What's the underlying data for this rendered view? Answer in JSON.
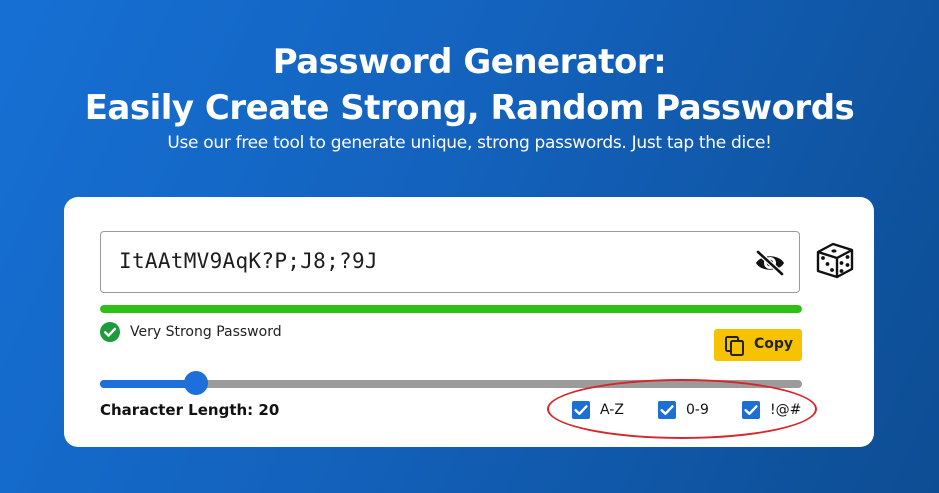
{
  "header": {
    "title_line1": "Password Generator:",
    "title_line2": "Easily Create Strong, Random Passwords",
    "subtitle": "Use our free tool to generate unique, strong passwords. Just tap the dice!"
  },
  "generator": {
    "password": "ItAAtMV9AqK?P;J8;?9J",
    "visibility_icon": "eye-off-icon",
    "dice_icon": "dice-icon",
    "strength": {
      "label": "Very Strong Password",
      "level": 1.0,
      "color": "#2ec013",
      "icon": "check-circle-icon"
    },
    "copy_button": {
      "label": "Copy",
      "icon": "copy-icon",
      "color": "#f7c300"
    },
    "length": {
      "label": "Character Length: 20",
      "value": 20
    },
    "options": [
      {
        "label": "A-Z",
        "checked": true
      },
      {
        "label": "0-9",
        "checked": true
      },
      {
        "label": "!@#",
        "checked": true
      }
    ]
  },
  "colors": {
    "accent": "#1d6fd9",
    "annotation_ring": "#d7262b"
  }
}
